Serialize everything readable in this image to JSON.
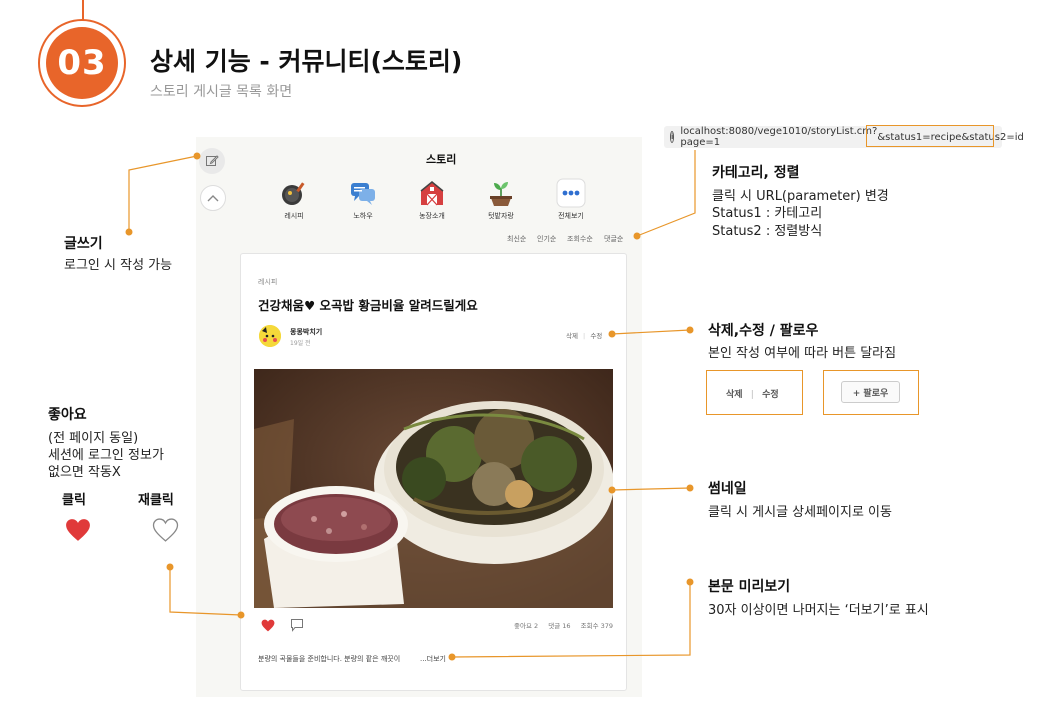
{
  "header": {
    "badge": "03",
    "title": "상세 기능 - 커뮤니티(스토리)",
    "subtitle": "스토리 게시글 목록 화면"
  },
  "browser": {
    "url_base": "localhost:8080/vege1010/storyList.cm?page=1",
    "url_params": "&status1=recipe&status2=id"
  },
  "app": {
    "title": "스토리",
    "categories": [
      {
        "label": "레시피",
        "icon": "pan-icon"
      },
      {
        "label": "노하우",
        "icon": "chat-bubbles-icon"
      },
      {
        "label": "농장소개",
        "icon": "barn-icon"
      },
      {
        "label": "텃밭자랑",
        "icon": "sprout-icon"
      },
      {
        "label": "전체보기",
        "icon": "more-dots-icon"
      }
    ],
    "sorts": [
      "최신순",
      "인기순",
      "조회수순",
      "댓글순"
    ],
    "post": {
      "category": "레시피",
      "title": "건강채움♥ 오곡밥 황금비율 알려드릴게요",
      "author": "몽몽박치기",
      "date": "19일 전",
      "delete_label": "삭제",
      "edit_label": "수정",
      "likes": "좋아요 2",
      "comments": "댓글 16",
      "views": "조회수 379",
      "preview": "분량의 곡물들을 준비합니다. 분량의 팥은 깨끗이",
      "more": "...더보기"
    }
  },
  "annotations": {
    "write": {
      "title": "글쓰기",
      "desc": "로그인 시 작성 가능"
    },
    "like": {
      "title": "좋아요",
      "desc": [
        "(전 페이지 동일)",
        "세션에 로그인 정보가",
        "없으면 작동X"
      ],
      "click_label": "클릭",
      "reclick_label": "재클릭"
    },
    "category": {
      "title": "카테고리, 정렬",
      "desc": [
        "클릭 시 URL(parameter) 변경",
        "Status1 : 카테고리",
        "Status2 : 정렬방식"
      ]
    },
    "edit": {
      "title": "삭제,수정 / 팔로우",
      "desc": "본인 작성 여부에 따라 버튼 달라짐",
      "delete_label": "삭제",
      "edit_label": "수정",
      "follow_label": "+ 팔로우"
    },
    "thumbnail": {
      "title": "썸네일",
      "desc": "클릭 시 게시글 상세페이지로 이동"
    },
    "preview": {
      "title": "본문 미리보기",
      "desc": "30자 이상이면 나머지는 ‘더보기’로 표시"
    }
  },
  "colors": {
    "accent": "#e8652a",
    "annotation": "#e8962a",
    "heart": "#e03a3a"
  }
}
